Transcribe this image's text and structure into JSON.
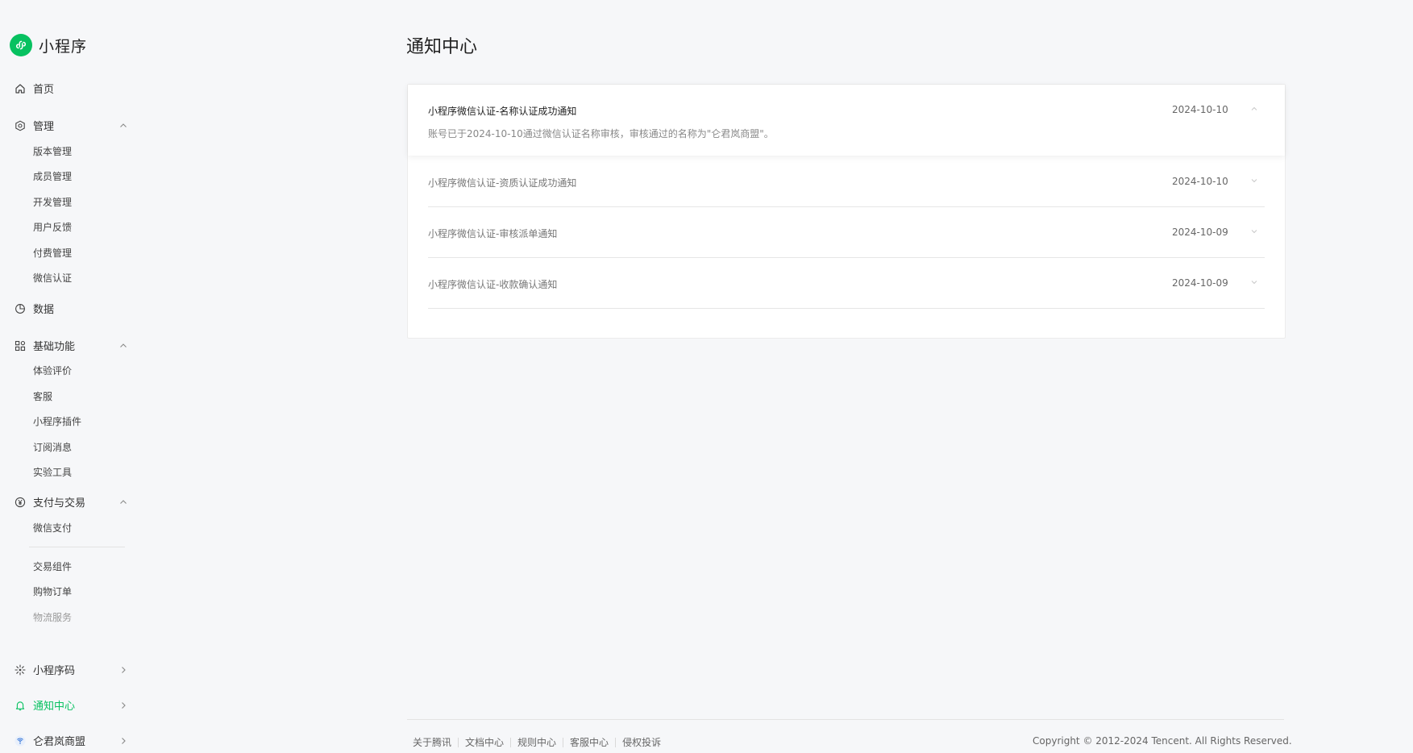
{
  "brand": {
    "name": "小程序",
    "accent": "#07c160"
  },
  "sidebar": {
    "home": {
      "label": "首页",
      "icon": "home-icon"
    },
    "manage": {
      "label": "管理",
      "icon": "hexagon-settings-icon",
      "items": [
        "版本管理",
        "成员管理",
        "开发管理",
        "用户反馈",
        "付费管理",
        "微信认证"
      ]
    },
    "data": {
      "label": "数据",
      "icon": "pie-chart-icon"
    },
    "basic": {
      "label": "基础功能",
      "icon": "grid-icon",
      "items": [
        "体验评价",
        "客服",
        "小程序插件",
        "订阅消息",
        "实验工具"
      ]
    },
    "pay": {
      "label": "支付与交易",
      "icon": "yuan-icon",
      "items": [
        "微信支付",
        "交易组件",
        "购物订单",
        "物流服务"
      ]
    },
    "qrcode": {
      "label": "小程序码",
      "icon": "sun-code-icon"
    },
    "notice": {
      "label": "通知中心",
      "icon": "bell-icon"
    },
    "account": {
      "label": "仑君岚商盟",
      "icon": "avatar-icon"
    }
  },
  "main": {
    "title": "通知中心",
    "notices": [
      {
        "title": "小程序微信认证-名称认证成功通知",
        "date": "2024-10-10",
        "body": "账号已于2024-10-10通过微信认证名称审核，审核通过的名称为\"仑君岚商盟\"。",
        "expanded": true
      },
      {
        "title": "小程序微信认证-资质认证成功通知",
        "date": "2024-10-10",
        "expanded": false
      },
      {
        "title": "小程序微信认证-审核派单通知",
        "date": "2024-10-09",
        "expanded": false
      },
      {
        "title": "小程序微信认证-收款确认通知",
        "date": "2024-10-09",
        "expanded": false
      }
    ]
  },
  "footer": {
    "links": [
      "关于腾讯",
      "文档中心",
      "规则中心",
      "客服中心",
      "侵权投诉"
    ],
    "copyright": "Copyright © 2012-2024 Tencent. All Rights Reserved."
  }
}
